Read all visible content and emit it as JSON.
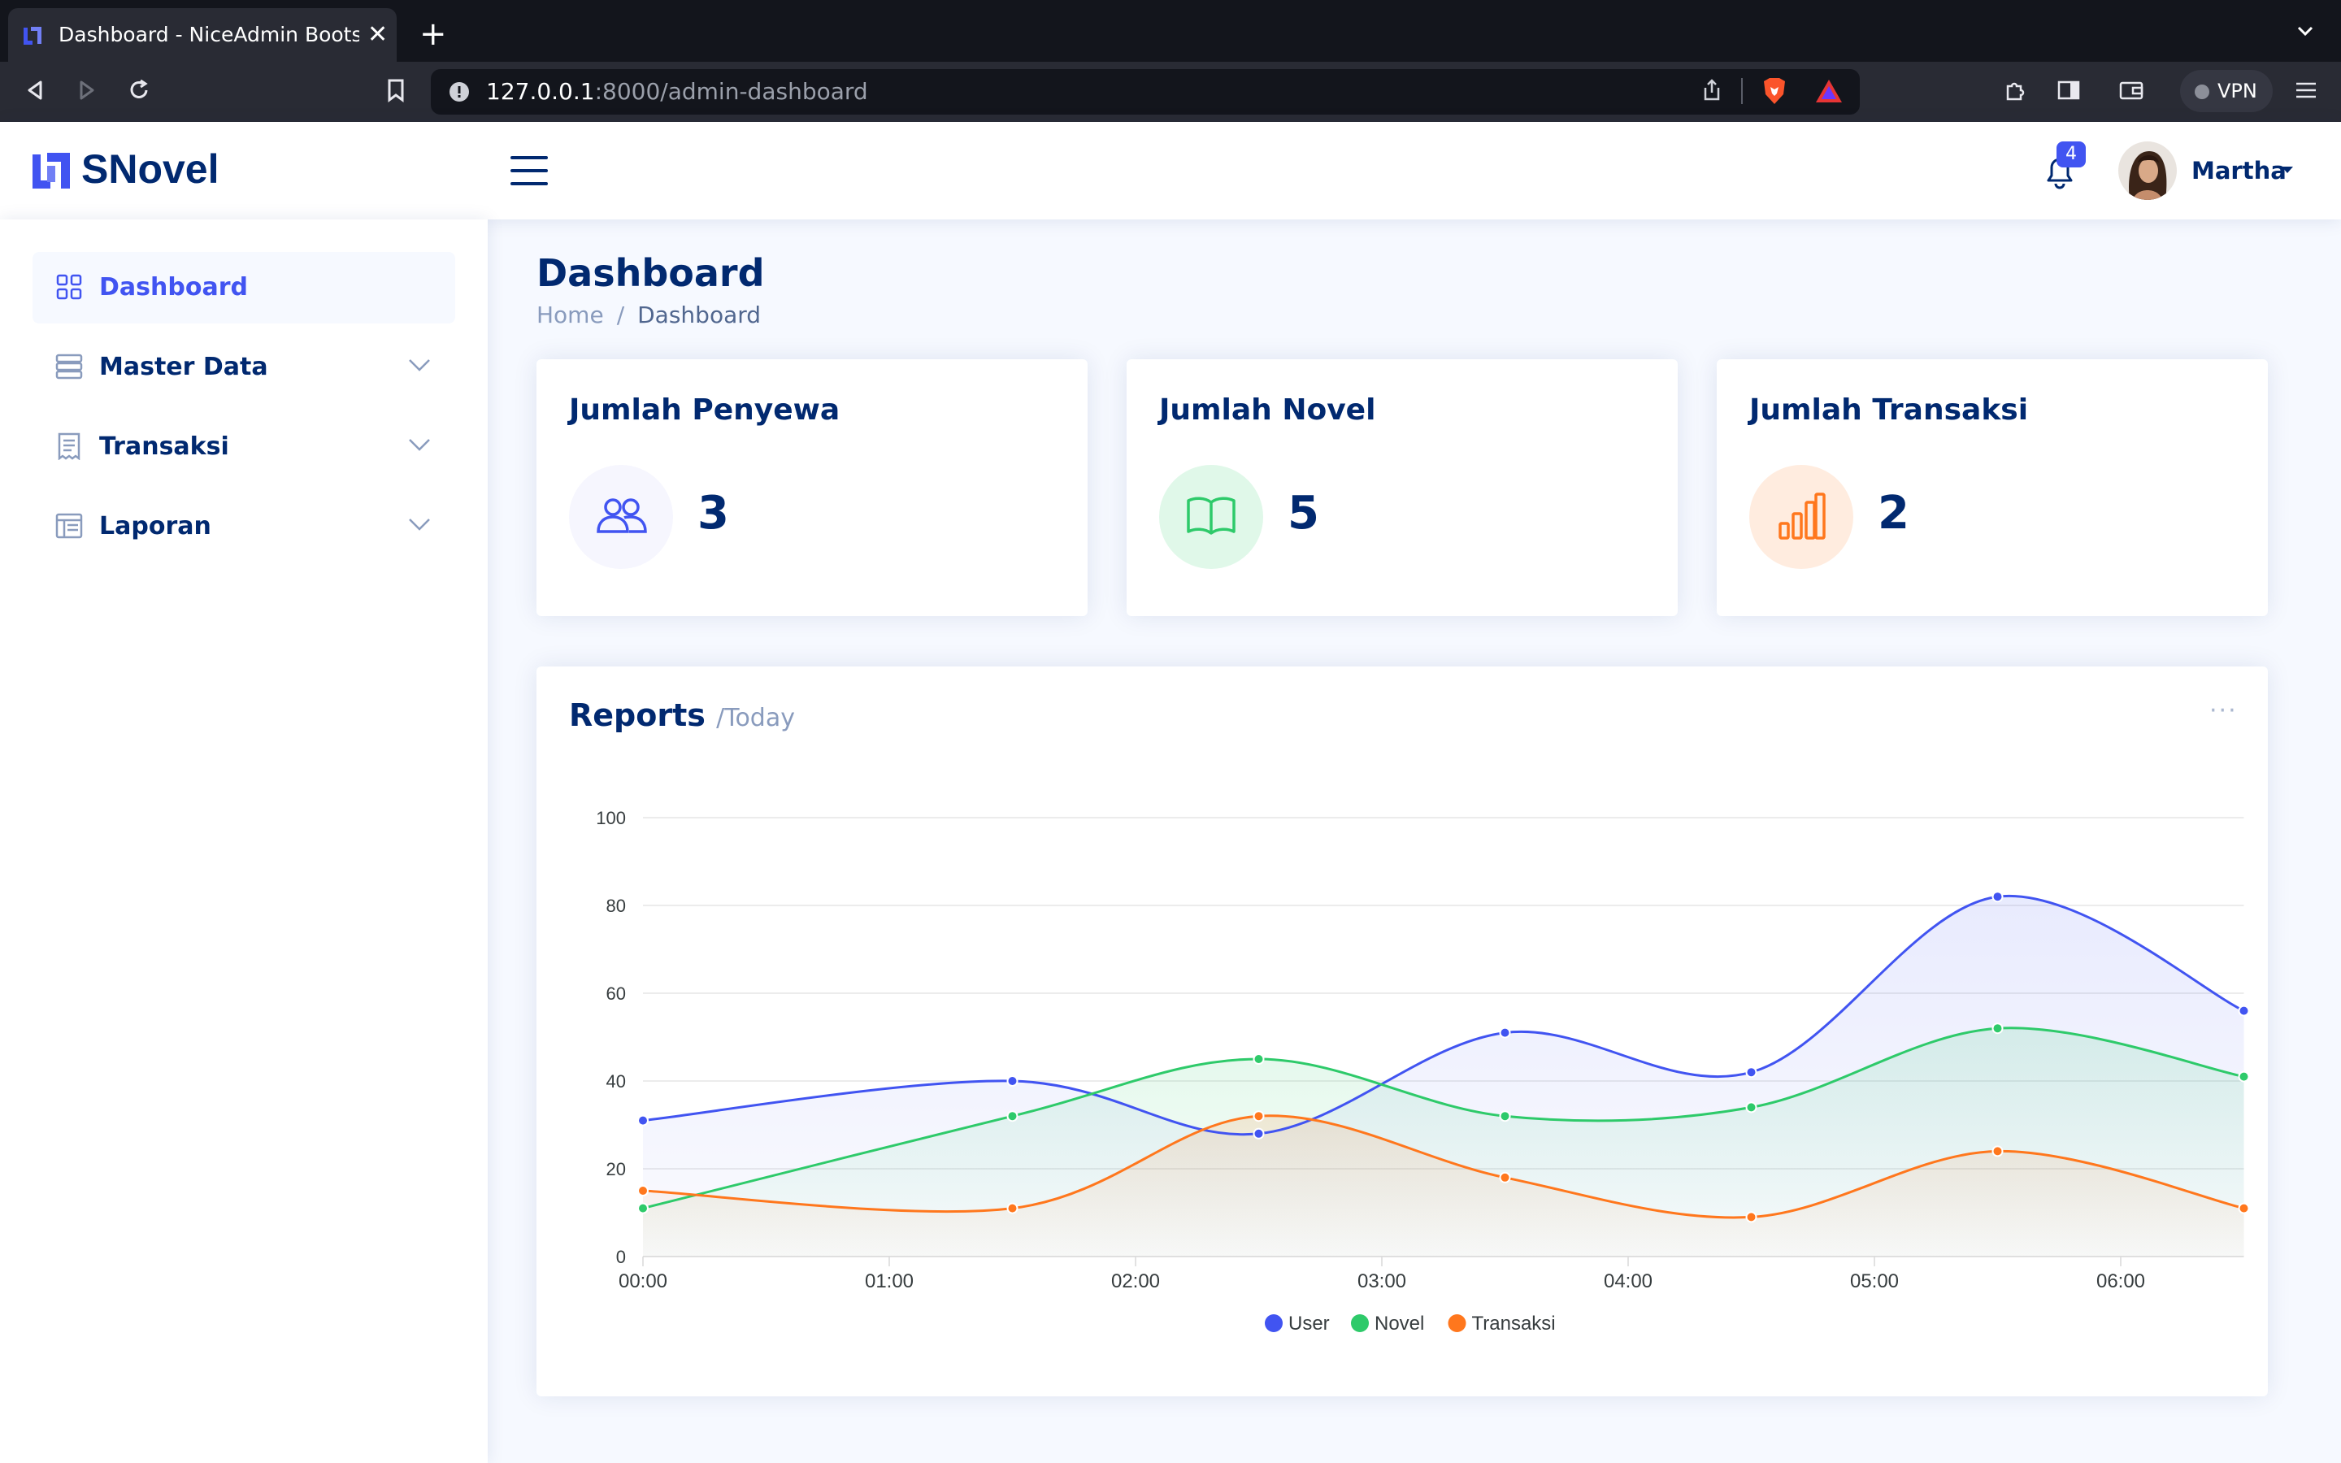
{
  "browser": {
    "tab_title": "Dashboard - NiceAdmin Bootstrap",
    "url_host": "127.0.0.1",
    "url_path": ":8000/admin-dashboard",
    "vpn_label": "VPN"
  },
  "header": {
    "logo": "SNovel",
    "notification_count": "4",
    "user_name": "Martha"
  },
  "sidebar": {
    "items": [
      {
        "label": "Dashboard",
        "icon": "grid-icon",
        "active": true
      },
      {
        "label": "Master Data",
        "icon": "database-icon",
        "active": false
      },
      {
        "label": "Transaksi",
        "icon": "receipt-icon",
        "active": false
      },
      {
        "label": "Laporan",
        "icon": "layout-text-icon",
        "active": false
      }
    ]
  },
  "page": {
    "title": "Dashboard",
    "breadcrumb": [
      "Home",
      "Dashboard"
    ]
  },
  "cards": [
    {
      "title": "Jumlah Penyewa",
      "value": "3",
      "icon": "people-icon",
      "color": "#4154f1",
      "bg": "#f6f6fe"
    },
    {
      "title": "Jumlah Novel",
      "value": "5",
      "icon": "book-icon",
      "color": "#2eca6a",
      "bg": "#e0f8e9"
    },
    {
      "title": "Jumlah Transaksi",
      "value": "2",
      "icon": "bar-chart-icon",
      "color": "#ff771d",
      "bg": "#ffecdf"
    }
  ],
  "reports": {
    "title": "Reports",
    "subtitle": "/Today",
    "more_label": "···"
  },
  "chart_data": {
    "type": "area",
    "x": [
      "00:00",
      "01:30",
      "02:30",
      "03:30",
      "04:30",
      "05:30",
      "06:30"
    ],
    "x_ticks": [
      "00:00",
      "01:00",
      "02:00",
      "03:00",
      "04:00",
      "05:00",
      "06:00"
    ],
    "y_ticks": [
      "0",
      "20",
      "40",
      "60",
      "80",
      "100"
    ],
    "ylim": [
      0,
      100
    ],
    "grid": true,
    "legend_position": "bottom",
    "series": [
      {
        "name": "User",
        "color": "#4154f1",
        "values": [
          31,
          40,
          28,
          51,
          42,
          82,
          56
        ]
      },
      {
        "name": "Novel",
        "color": "#2eca6a",
        "values": [
          11,
          32,
          45,
          32,
          34,
          52,
          41
        ]
      },
      {
        "name": "Transaksi",
        "color": "#ff771d",
        "values": [
          15,
          11,
          32,
          18,
          9,
          24,
          11
        ]
      }
    ]
  }
}
